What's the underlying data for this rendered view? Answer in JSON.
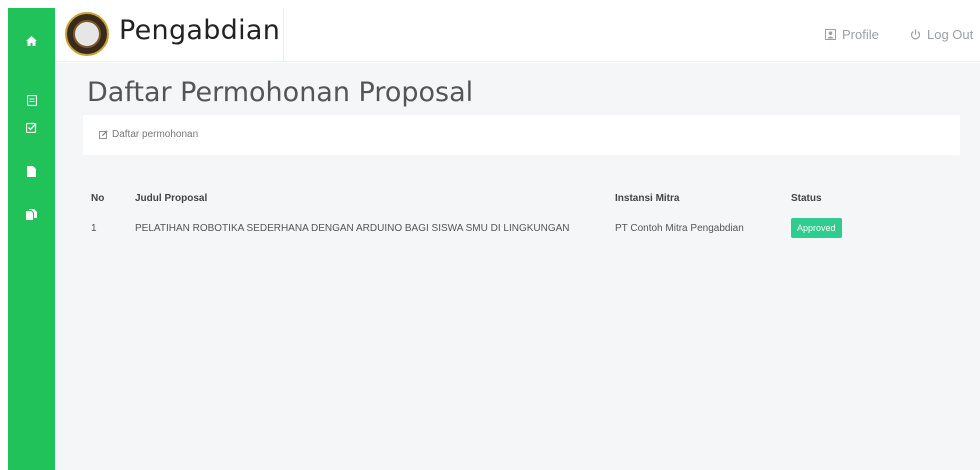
{
  "app": {
    "brand": "Pengabdian"
  },
  "sidebar": {
    "items": [
      {
        "icon": "home-icon"
      },
      {
        "icon": "document-icon"
      },
      {
        "icon": "checkbox-icon"
      },
      {
        "icon": "file-icon"
      },
      {
        "icon": "files-icon"
      }
    ]
  },
  "topnav": {
    "profile_label": "Profile",
    "logout_label": "Log Out"
  },
  "page": {
    "title": "Daftar Permohonan Proposal",
    "card_label": "Daftar permohonan"
  },
  "table": {
    "headers": {
      "no": "No",
      "judul": "Judul Proposal",
      "instansi": "Instansi Mitra",
      "status": "Status"
    },
    "rows": [
      {
        "no": "1",
        "judul": "PELATIHAN ROBOTIKA SEDERHANA DENGAN ARDUINO BAGI SISWA SMU DI LINGKUNGAN",
        "instansi": "PT Contoh Mitra Pengabdian",
        "status": "Approved"
      }
    ]
  },
  "colors": {
    "sidebar": "#22c25a",
    "badge": "#2ecc8f",
    "content_bg": "#f5f6f7"
  }
}
